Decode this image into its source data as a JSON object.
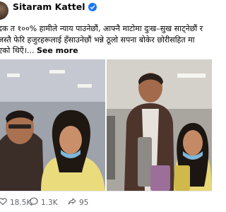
{
  "post": {
    "author": "Sitaram Kattel",
    "meta": "·",
    "text_lines": [
      "दक त १००% हामीले न्याय पाउनेछौं, आफ्नै माटोमा दुःख–सुख साट्नेछौं र",
      "जस्तै फेरि हजुरहरूलाई हँसाउनेछौं भन्ने ठूलो सपना बोकेर छोरीसहित मा",
      "एको थिएँ।..."
    ],
    "see_more": "See more"
  },
  "stats": {
    "reactions": "18.5K",
    "comments": "1.3K",
    "shares": "95"
  },
  "colors": {
    "verified": "#1877f2",
    "secondary_text": "#65676b"
  },
  "icons": {
    "verified": "verified-badge-icon",
    "reactions": "heart-icon",
    "comments": "comment-icon",
    "shares": "share-icon"
  }
}
